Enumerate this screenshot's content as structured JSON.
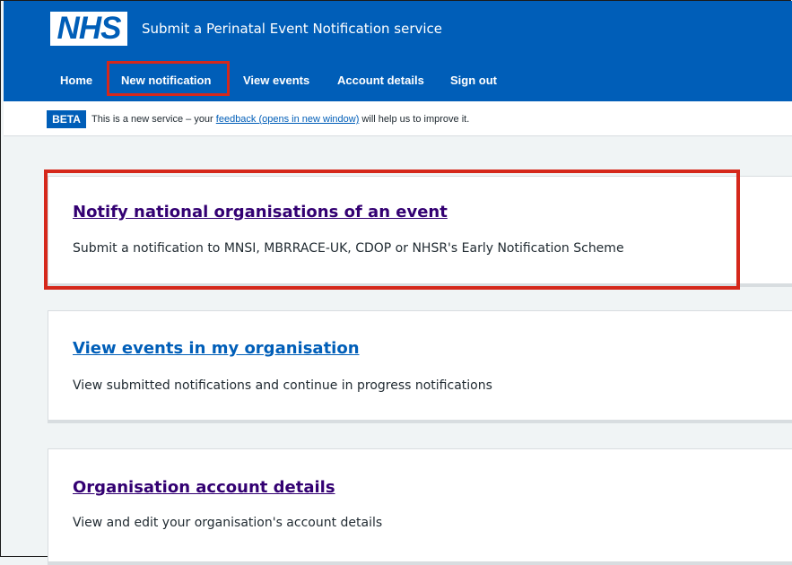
{
  "header": {
    "logo_text": "NHS",
    "service_name": "Submit a Perinatal Event Notification service",
    "nav": [
      {
        "label": "Home"
      },
      {
        "label": "New notification"
      },
      {
        "label": "View events"
      },
      {
        "label": "Account details"
      },
      {
        "label": "Sign out"
      }
    ]
  },
  "phase_banner": {
    "tag": "BETA",
    "text_before": "This is a new service – your ",
    "link_text": "feedback (opens in new window)",
    "text_after": " will help us to improve it."
  },
  "cards": [
    {
      "title": "Notify national organisations of an event",
      "description": "Submit a notification to MNSI, MBRRACE-UK, CDOP or NHSR's Early Notification Scheme",
      "title_color": "#330072"
    },
    {
      "title": "View events in my organisation",
      "description": "View submitted notifications and continue in progress notifications",
      "title_color": "#005eb8"
    },
    {
      "title": "Organisation account details",
      "description": "View and edit your organisation's account details",
      "title_color": "#330072"
    }
  ],
  "colors": {
    "nhs_blue": "#005eb8",
    "highlight_red": "#d5281b",
    "visited_link": "#330072",
    "background": "#f0f4f5"
  },
  "highlights": [
    "New notification",
    "Notify national organisations of an event"
  ]
}
